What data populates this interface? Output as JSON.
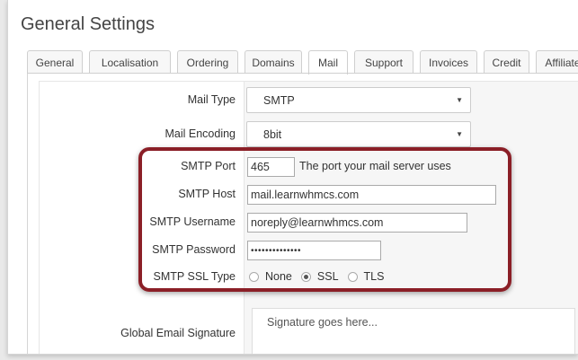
{
  "page": {
    "title": "General Settings"
  },
  "tabs": [
    {
      "label": "General"
    },
    {
      "label": "Localisation"
    },
    {
      "label": "Ordering"
    },
    {
      "label": "Domains"
    },
    {
      "label": "Mail",
      "active": true
    },
    {
      "label": "Support"
    },
    {
      "label": "Invoices"
    },
    {
      "label": "Credit"
    },
    {
      "label": "Affiliate"
    }
  ],
  "form": {
    "mail_type": {
      "label": "Mail Type",
      "value": "SMTP"
    },
    "mail_encoding": {
      "label": "Mail Encoding",
      "value": "8bit"
    },
    "smtp_port": {
      "label": "SMTP Port",
      "value": "465",
      "hint": "The port your mail server uses"
    },
    "smtp_host": {
      "label": "SMTP Host",
      "value": "mail.learnwhmcs.com"
    },
    "smtp_username": {
      "label": "SMTP Username",
      "value": "noreply@learnwhmcs.com"
    },
    "smtp_password": {
      "label": "SMTP Password",
      "value": "••••••••••••••"
    },
    "smtp_ssl_type": {
      "label": "SMTP SSL Type",
      "options": [
        "None",
        "SSL",
        "TLS"
      ],
      "selected": "SSL"
    },
    "global_email_signature": {
      "label": "Global Email Signature",
      "placeholder": "Signature goes here..."
    }
  },
  "icons": {
    "select_caret": "caret-down-icon"
  },
  "colors": {
    "highlight_border": "#8b1f27"
  }
}
